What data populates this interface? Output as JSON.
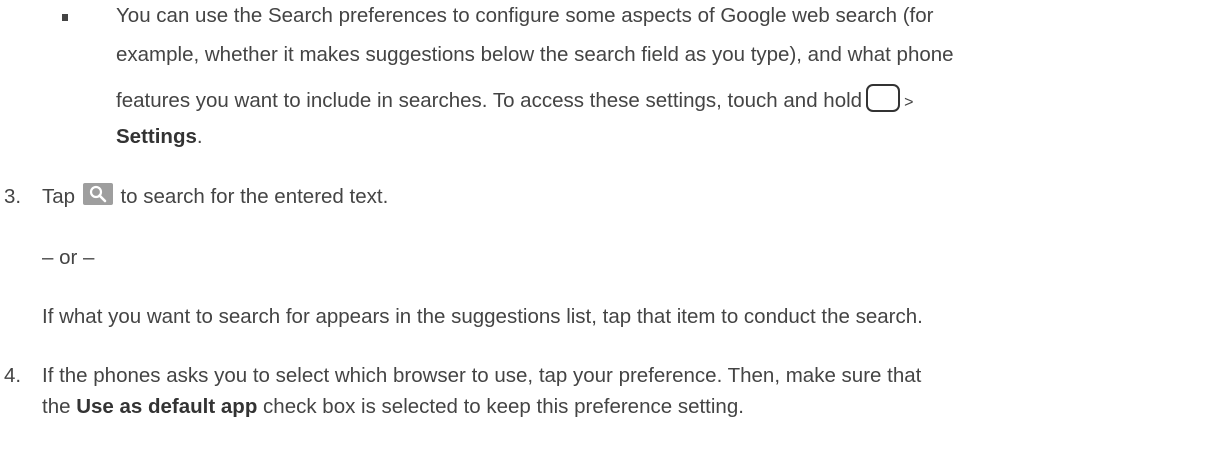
{
  "bullet": {
    "line1": "You can use the Search preferences to configure some aspects of Google web search (for",
    "line2": "example, whether it makes suggestions below the search field as you type), and what phone",
    "line3_before": "features you want to include in searches. To access these settings, touch and hold",
    "line3_gt": ">",
    "line4_bold": "Settings",
    "line4_end": "."
  },
  "step3": {
    "number": "3.",
    "tap": "Tap",
    "after_icon": "to search for the entered text.",
    "or": "– or –",
    "alt": "If what you want to search for appears in the suggestions list, tap that item to conduct the search."
  },
  "step4": {
    "number": "4.",
    "line1": "If the phones asks you to select which browser to use, tap your preference. Then, make sure that",
    "line2_before": "the",
    "line2_bold": "Use as default app",
    "line2_after": "check box is selected to keep this preference setting."
  },
  "icons": {
    "home_key": "home-key-icon",
    "search_key": "search-key-icon"
  },
  "colors": {
    "text": "#444444",
    "search_key_bg": "#9e9e9e"
  }
}
